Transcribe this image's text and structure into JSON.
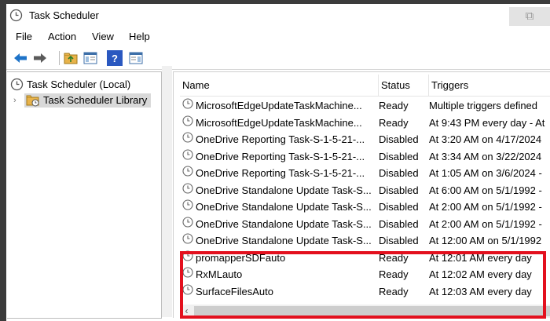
{
  "window": {
    "title": "Task Scheduler",
    "restore_glyph": "⧉"
  },
  "menu": [
    "File",
    "Action",
    "View",
    "Help"
  ],
  "toolbar": {
    "icons": [
      "back-arrow-icon",
      "forward-arrow-icon",
      "folder-up-icon",
      "show-hide-console-tree-icon",
      "help-icon",
      "show-hide-action-pane-icon"
    ],
    "help_glyph": "?"
  },
  "tree": {
    "root_label": "Task Scheduler (Local)",
    "library_label": "Task Scheduler Library",
    "expand_glyph": "›"
  },
  "columns": [
    "Name",
    "Status",
    "Triggers"
  ],
  "tasks": [
    {
      "name": "MicrosoftEdgeUpdateTaskMachine...",
      "status": "Ready",
      "trigger": "Multiple triggers defined"
    },
    {
      "name": "MicrosoftEdgeUpdateTaskMachine...",
      "status": "Ready",
      "trigger": "At 9:43 PM every day - At"
    },
    {
      "name": "OneDrive Reporting Task-S-1-5-21-...",
      "status": "Disabled",
      "trigger": "At 3:20 AM on 4/17/2024"
    },
    {
      "name": "OneDrive Reporting Task-S-1-5-21-...",
      "status": "Disabled",
      "trigger": "At 3:34 AM on 3/22/2024"
    },
    {
      "name": "OneDrive Reporting Task-S-1-5-21-...",
      "status": "Disabled",
      "trigger": "At 1:05 AM on 3/6/2024 -"
    },
    {
      "name": "OneDrive Standalone Update Task-S...",
      "status": "Disabled",
      "trigger": "At 6:00 AM on 5/1/1992 -"
    },
    {
      "name": "OneDrive Standalone Update Task-S...",
      "status": "Disabled",
      "trigger": "At 2:00 AM on 5/1/1992 -"
    },
    {
      "name": "OneDrive Standalone Update Task-S...",
      "status": "Disabled",
      "trigger": "At 2:00 AM on 5/1/1992 -"
    },
    {
      "name": "OneDrive Standalone Update Task-S...",
      "status": "Disabled",
      "trigger": "At 12:00 AM on 5/1/1992"
    },
    {
      "name": "promapperSDFauto",
      "status": "Ready",
      "trigger": "At 12:01 AM every day"
    },
    {
      "name": "RxMLauto",
      "status": "Ready",
      "trigger": "At 12:02 AM every day"
    },
    {
      "name": "SurfaceFilesAuto",
      "status": "Ready",
      "trigger": "At 12:03 AM every day"
    }
  ],
  "scrollbar": {
    "left_glyph": "‹"
  },
  "colors": {
    "highlight_border": "#e3101e",
    "selection_bg": "#d9d9d9"
  }
}
